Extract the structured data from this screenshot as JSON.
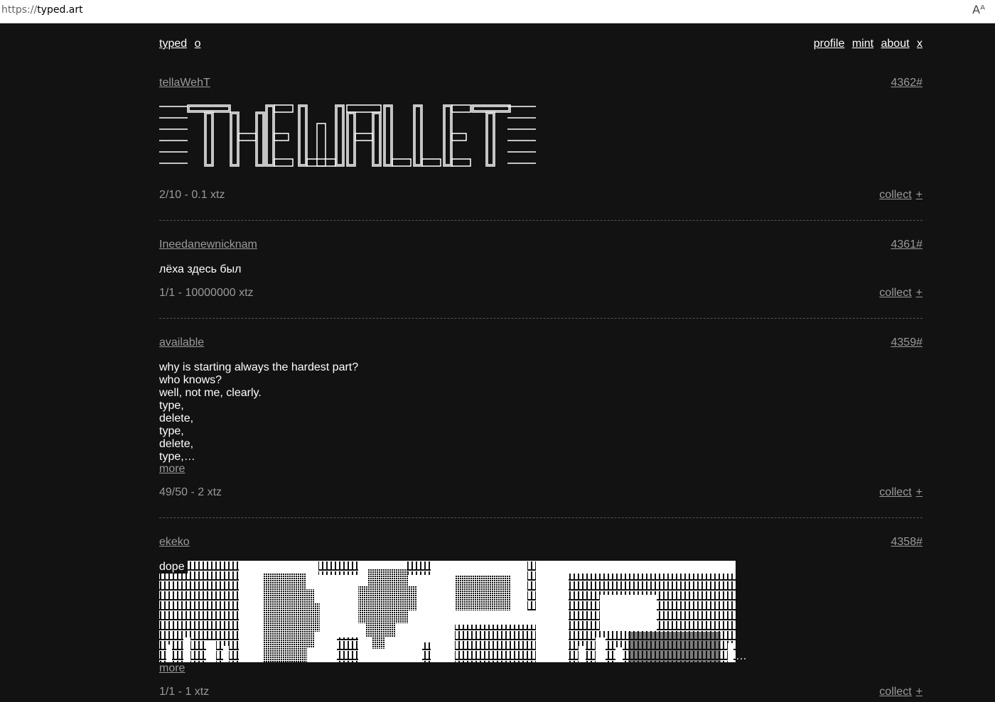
{
  "browser": {
    "url_proto": "https://",
    "url_host": "typed.art",
    "reader_icon": "reader-mode-icon"
  },
  "nav": {
    "left": [
      "typed",
      "o"
    ],
    "right": [
      "profile",
      "mint",
      "about",
      "x"
    ]
  },
  "posts": [
    {
      "author": "tellaWehT",
      "number": "4362#",
      "art_kind": "ascii-art-the-wallet",
      "price": "2/10 - 0.1 xtz",
      "collect": "collect",
      "plus": "+"
    },
    {
      "author": "Ineedanewnicknam",
      "number": "4361#",
      "text": "лёха здесь был",
      "price": "1/1 - 10000000 xtz",
      "collect": "collect",
      "plus": "+"
    },
    {
      "author": "available",
      "number": "4359#",
      "text": "why is starting always the hardest part?\nwho knows?\nwell, not me, clearly.\ntype,\ndelete,\ntype,\ndelete,\ntype,…",
      "more": "more",
      "price": "49/50 - 2 xtz",
      "collect": "collect",
      "plus": "+"
    },
    {
      "author": "ekeko",
      "number": "4358#",
      "text": "dope",
      "art_kind": "ascii-art-dope",
      "ellipsis": "…",
      "more": "more",
      "price": "1/1 - 1 xtz",
      "collect": "collect",
      "plus": "+"
    }
  ]
}
